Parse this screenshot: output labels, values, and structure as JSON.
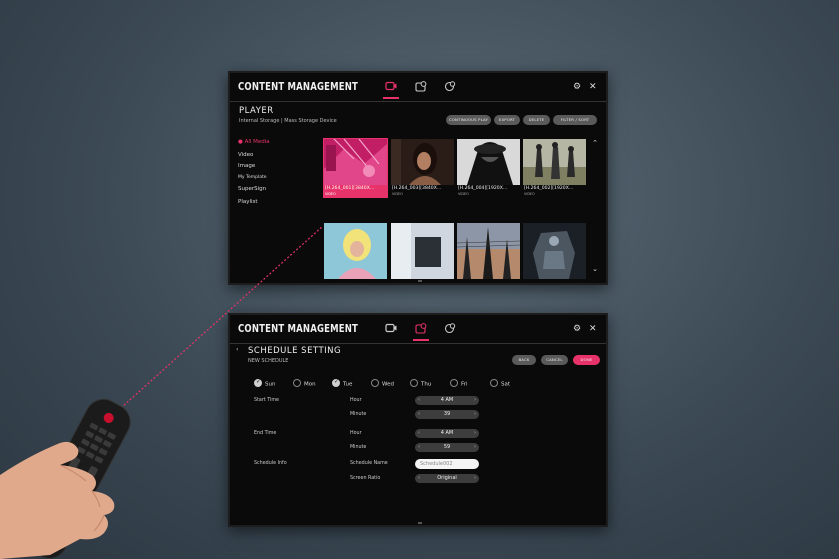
{
  "screen1": {
    "title": "CONTENT MANAGEMENT",
    "page_title": "PLAYER",
    "page_subtitle": "Internal Storage | Mass Storage Device",
    "buttons": {
      "continuous_play": "CONTINUOUS PLAY",
      "export": "EXPORT",
      "delete": "DELETE",
      "filter_sort": "FILTER / SORT"
    },
    "sidebar": [
      {
        "label": "All Media"
      },
      {
        "label": "Video"
      },
      {
        "label": "Image"
      },
      {
        "label": "My Template"
      },
      {
        "label": "SuperSign"
      },
      {
        "label": "Playlist"
      }
    ],
    "thumbs": [
      {
        "caption": "[H.264_001][3840X...",
        "type": "VIDEO"
      },
      {
        "caption": "[H.264_003][3840X...",
        "type": "VIDEO"
      },
      {
        "caption": "[H.264_004][1920X...",
        "type": "VIDEO"
      },
      {
        "caption": "[H.264_002][1920X...",
        "type": "VIDEO"
      }
    ]
  },
  "screen2": {
    "title": "CONTENT MANAGEMENT",
    "page_title": "SCHEDULE SETTING",
    "page_subtitle": "NEW SCHEDULE",
    "buttons": {
      "back": "BACK",
      "cancel": "CANCEL",
      "done": "DONE"
    },
    "days": [
      {
        "label": "Sun",
        "checked": true
      },
      {
        "label": "Mon",
        "checked": false
      },
      {
        "label": "Tue",
        "checked": true
      },
      {
        "label": "Wed",
        "checked": false
      },
      {
        "label": "Thu",
        "checked": false
      },
      {
        "label": "Fri",
        "checked": false
      },
      {
        "label": "Sat",
        "checked": false
      }
    ],
    "start_time": {
      "label": "Start Time",
      "hour_label": "Hour",
      "hour": "4 AM",
      "minute_label": "Minute",
      "minute": "39"
    },
    "end_time": {
      "label": "End Time",
      "hour_label": "Hour",
      "hour": "4 AM",
      "minute_label": "Minute",
      "minute": "59"
    },
    "schedule_info": {
      "label": "Schedule Info",
      "name_label": "Schedule Name",
      "name_value": "Schedule002",
      "ratio_label": "Screen Ratio",
      "ratio_value": "Original"
    }
  },
  "colors": {
    "accent": "#e8336a",
    "screen_bg": "#0a0a0a",
    "backdrop": "#3c4a55"
  }
}
